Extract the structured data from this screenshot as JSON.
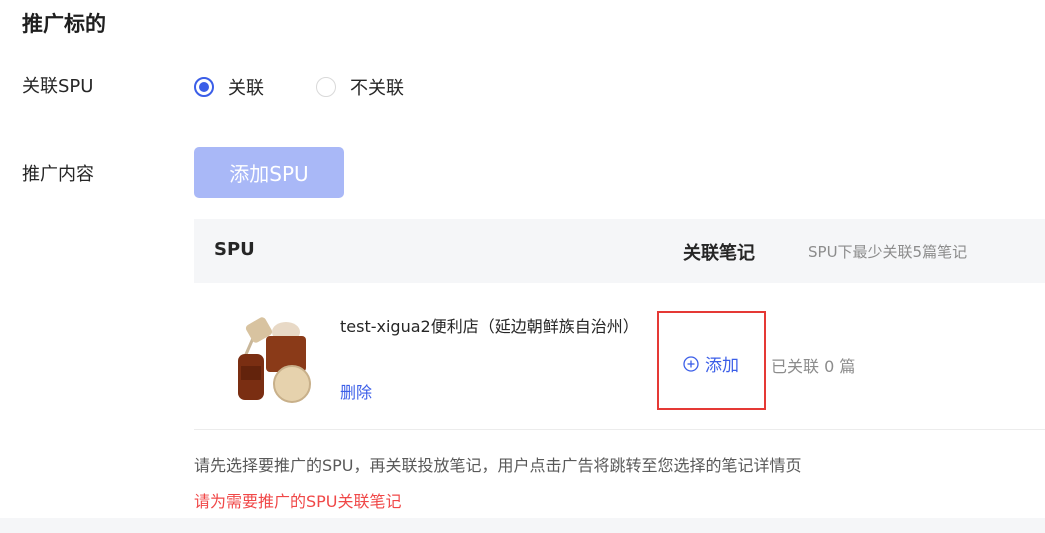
{
  "section": {
    "title": "推广标的"
  },
  "link_spu": {
    "label": "关联SPU",
    "options": [
      {
        "label": "关联",
        "checked": true
      },
      {
        "label": "不关联",
        "checked": false
      }
    ]
  },
  "content": {
    "label": "推广内容",
    "add_spu_button": "添加SPU"
  },
  "table": {
    "headers": {
      "spu": "SPU",
      "notes": "关联笔记",
      "notes_hint": "SPU下最少关联5篇笔记"
    },
    "rows": [
      {
        "name": "test-xigua2便利店（延边朝鲜族自治州）",
        "delete_label": "删除",
        "add_note_label": "添加",
        "linked_count": "已关联 0 篇"
      }
    ]
  },
  "help_text": "请先选择要推广的SPU，再关联投放笔记，用户点击广告将跳转至您选择的笔记详情页",
  "error_text": "请为需要推广的SPU关联笔记",
  "colors": {
    "primary": "#3b5ee8",
    "primary_disabled": "#a9b8f7",
    "error": "#f04848",
    "highlight": "#e53935"
  }
}
